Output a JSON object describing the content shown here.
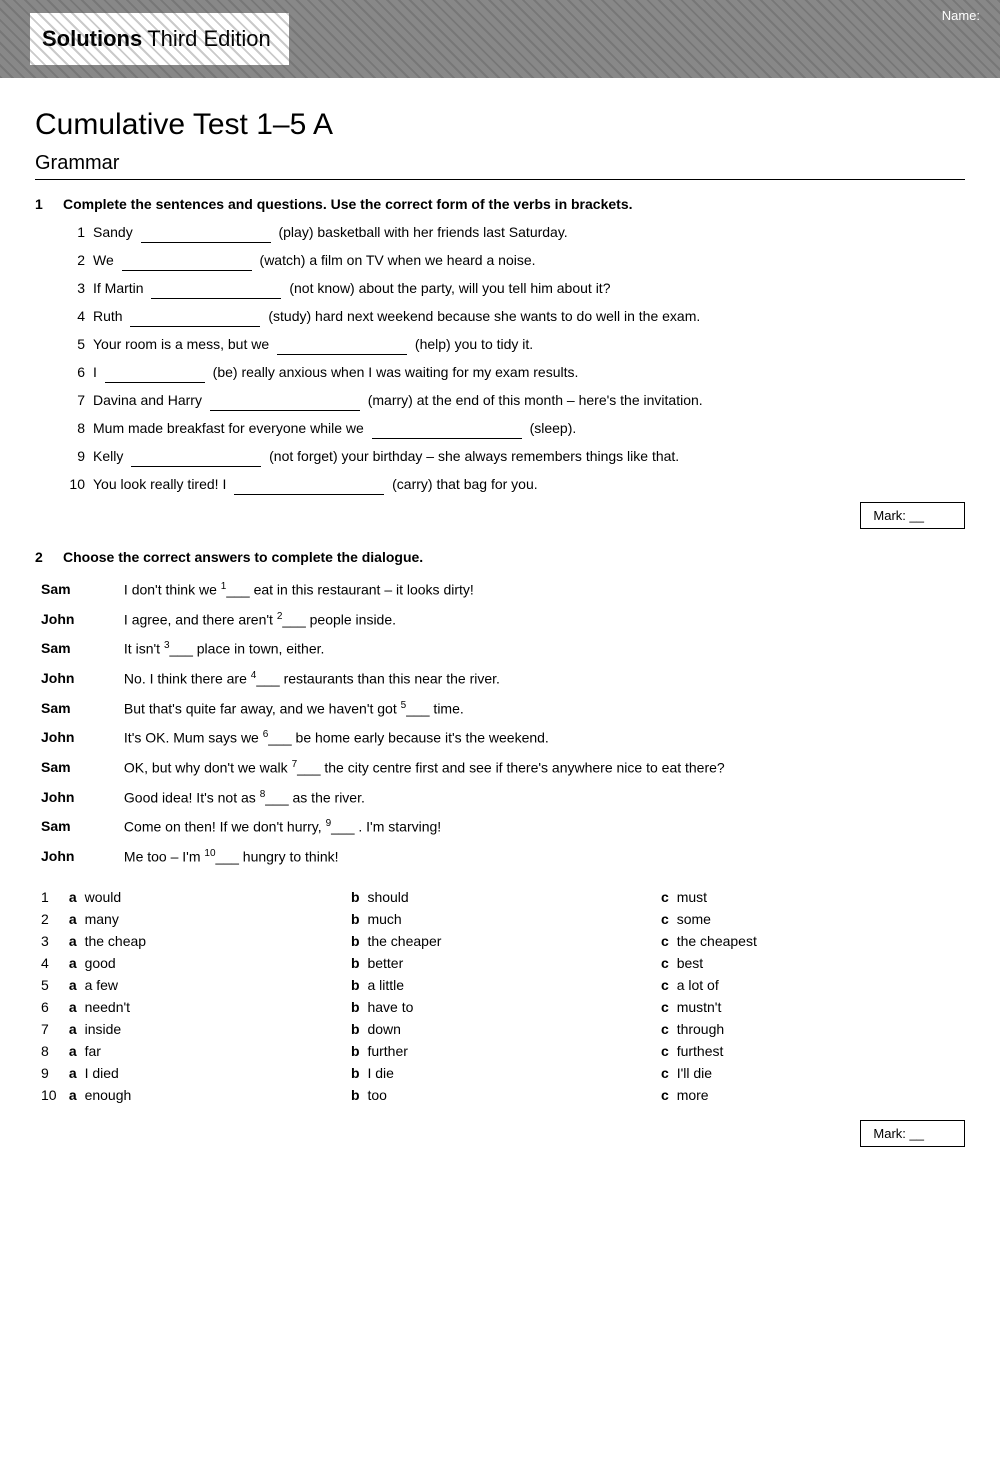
{
  "header": {
    "title_bold": "Solutions",
    "title_normal": " Third Edition",
    "name_label": "Name:"
  },
  "page": {
    "title": "Cumulative Test 1–5 A",
    "section": "Grammar"
  },
  "question1": {
    "number": "1",
    "instruction": "Complete the sentences and questions. Use the correct form of the verbs in brackets.",
    "items": [
      {
        "num": "1",
        "text_before": "Sandy",
        "blank_width": "130",
        "text_after": "(play) basketball with her friends last Saturday."
      },
      {
        "num": "2",
        "text_before": "We",
        "blank_width": "130",
        "text_after": "(watch) a film on TV when we heard a noise."
      },
      {
        "num": "3",
        "text_before": "If Martin",
        "blank_width": "130",
        "text_after": "(not know) about the party, will you tell him about it?"
      },
      {
        "num": "4",
        "text_before": "Ruth",
        "blank_width": "130",
        "text_after": "(study) hard next weekend because she wants to do well in the exam."
      },
      {
        "num": "5",
        "text_before": "Your room is a mess, but we",
        "blank_width": "130",
        "text_after": "(help) you to tidy it."
      },
      {
        "num": "6",
        "text_before": "I",
        "blank_width": "110",
        "text_after": "(be) really anxious when I was waiting for my exam results."
      },
      {
        "num": "7",
        "text_before": "Davina and Harry",
        "blank_width": "150",
        "text_after": "(marry) at the end of this month – here's the invitation."
      },
      {
        "num": "8",
        "text_before": "Mum made breakfast for everyone while we",
        "blank_width": "140",
        "text_after": "(sleep)."
      },
      {
        "num": "9",
        "text_before": "Kelly",
        "blank_width": "130",
        "text_after": "(not forget) your birthday – she always remembers things like that."
      },
      {
        "num": "10",
        "text_before": "You look really tired! I",
        "blank_width": "150",
        "text_after": "(carry) that bag for you."
      }
    ],
    "mark_label": "Mark: __"
  },
  "question2": {
    "number": "2",
    "instruction": "Choose the correct answers to complete the dialogue.",
    "dialogue": [
      {
        "speaker": "Sam",
        "sup": "1",
        "text_before": "I don't think we",
        "text_after": "eat in this restaurant – it looks dirty!"
      },
      {
        "speaker": "John",
        "sup": "2",
        "text_before": "I agree, and there aren't",
        "text_after": "people inside."
      },
      {
        "speaker": "Sam",
        "sup": "3",
        "text_before": "It isn't",
        "text_after": "place in town, either."
      },
      {
        "speaker": "John",
        "sup": "4",
        "text_before": "No. I think there are",
        "text_after": "restaurants than this near the river."
      },
      {
        "speaker": "Sam",
        "sup": "5",
        "text_before": "But that's quite far away, and we haven't got",
        "text_after": "time."
      },
      {
        "speaker": "John",
        "sup": "6",
        "text_before": "It's OK. Mum says we",
        "text_after": "be home early because it's the weekend."
      },
      {
        "speaker": "Sam",
        "sup": "7",
        "text_before": "OK, but why don't we walk",
        "text_after": "the city centre first and see if there's anywhere nice to eat there?"
      },
      {
        "speaker": "John",
        "sup": "8",
        "text_before": "Good idea! It's not as",
        "text_after": "as the river."
      },
      {
        "speaker": "Sam",
        "sup": "9",
        "text_before": "Come on then! If we don't hurry,",
        "text_after": ". I'm starving!"
      },
      {
        "speaker": "John",
        "sup": "10",
        "text_before": "Me too – I'm",
        "text_after": "hungry to think!"
      }
    ],
    "choices": [
      {
        "num": "1",
        "a": "would",
        "b": "should",
        "c": "must"
      },
      {
        "num": "2",
        "a": "many",
        "b": "much",
        "c": "some"
      },
      {
        "num": "3",
        "a": "the cheap",
        "b": "the cheaper",
        "c": "the cheapest"
      },
      {
        "num": "4",
        "a": "good",
        "b": "better",
        "c": "best"
      },
      {
        "num": "5",
        "a": "a few",
        "b": "a little",
        "c": "a lot of"
      },
      {
        "num": "6",
        "a": "needn't",
        "b": "have to",
        "c": "mustn't"
      },
      {
        "num": "7",
        "a": "inside",
        "b": "down",
        "c": "through"
      },
      {
        "num": "8",
        "a": "far",
        "b": "further",
        "c": "furthest"
      },
      {
        "num": "9",
        "a": "I died",
        "b": "I die",
        "c": "I'll die"
      },
      {
        "num": "10",
        "a": "enough",
        "b": "too",
        "c": "more"
      }
    ],
    "mark_label": "Mark: __"
  }
}
